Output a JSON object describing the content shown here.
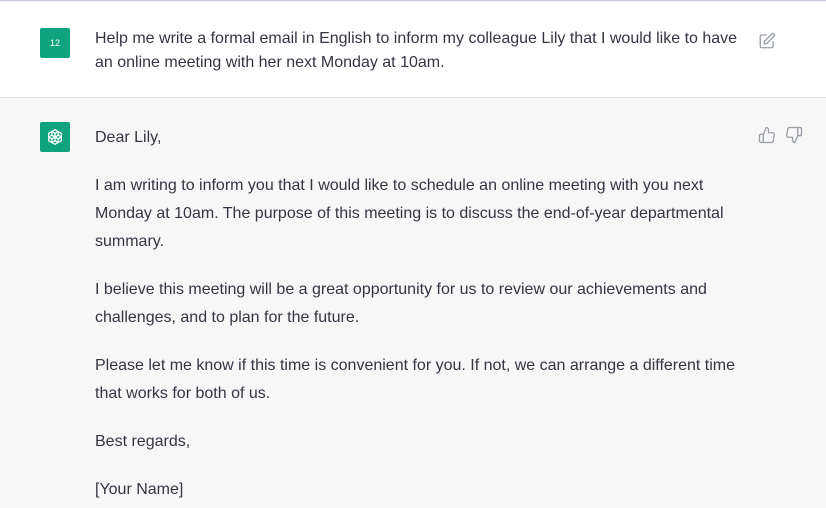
{
  "user_message": {
    "avatar_label": "12",
    "text": "Help me write a formal email in English to inform my colleague Lily that I would like to have an online meeting with her next Monday at 10am.",
    "edit_icon": "edit-icon"
  },
  "assistant_message": {
    "avatar_icon": "openai-logo-icon",
    "paragraphs": [
      "Dear Lily,",
      "I am writing to inform you that I would like to schedule an online meeting with you next Monday at 10am. The purpose of this meeting is to discuss the end-of-year departmental summary.",
      "I believe this meeting will be a great opportunity for us to review our achievements and challenges, and to plan for the future.",
      "Please let me know if this time is convenient for you. If not, we can arrange a different time that works for both of us.",
      "Best regards,",
      "[Your Name]"
    ],
    "feedback_icons": [
      "thumbs-up-icon",
      "thumbs-down-icon"
    ]
  },
  "colors": {
    "accent": "#10a37f",
    "user_bg": "#ffffff",
    "assistant_bg": "#f7f7f8",
    "text": "#343541"
  }
}
